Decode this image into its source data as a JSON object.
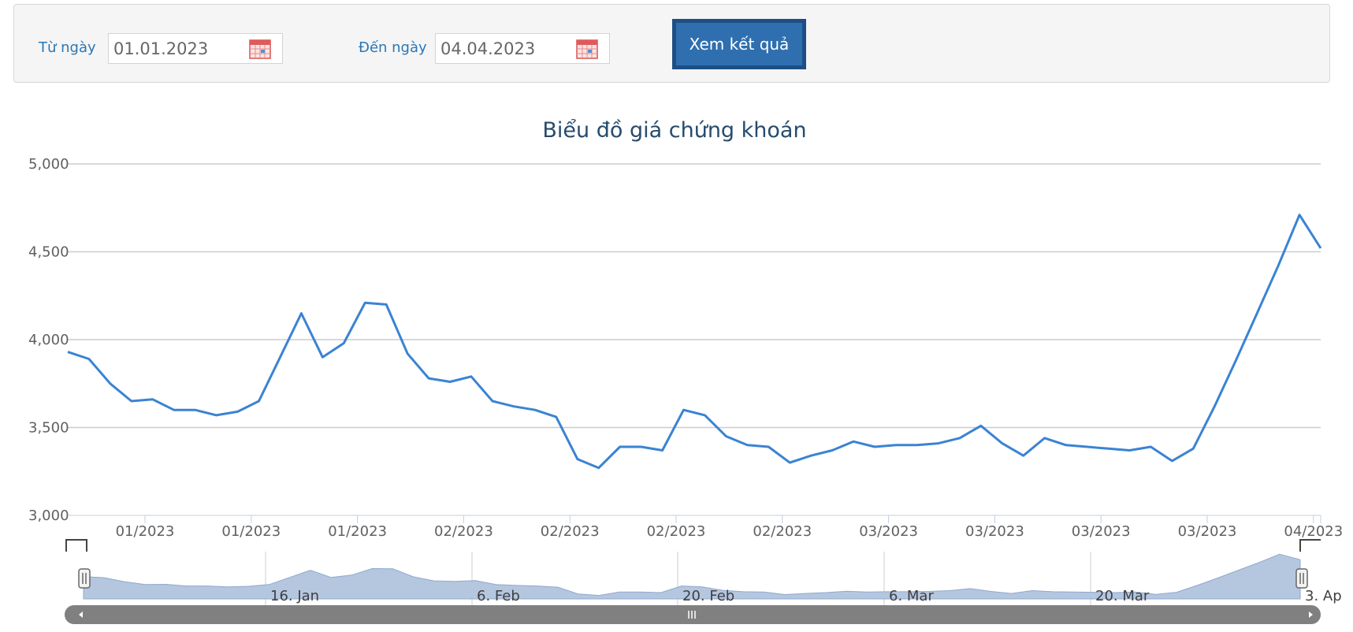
{
  "filter": {
    "from_label": "Từ ngày",
    "from_value": "01.01.2023",
    "to_label": "Đến ngày",
    "to_value": "04.04.2023",
    "submit_label": "Xem kết quả"
  },
  "colors": {
    "accent": "#2a77b6",
    "line": "#3a83d4",
    "button": "#2f6fb0",
    "navigator_fill": "#b5c6df"
  },
  "icons": {
    "calendar": "calendar-icon",
    "scroll_left": "arrow-left-icon",
    "scroll_right": "arrow-right-icon",
    "scrollbar_grip": "grip-icon",
    "handle": "handle-icon"
  },
  "chart_data": {
    "type": "line",
    "title": "Biểu đồ giá chứng khoán",
    "ylim": [
      3000,
      5000
    ],
    "y_ticks": [
      "3,000",
      "3,500",
      "4,000",
      "4,500",
      "5,000"
    ],
    "x_tick_labels": [
      "01/2023",
      "01/2023",
      "01/2023",
      "02/2023",
      "02/2023",
      "02/2023",
      "02/2023",
      "03/2023",
      "03/2023",
      "03/2023",
      "03/2023",
      "04/2023"
    ],
    "grid": true,
    "series": [
      {
        "values": [
          3930,
          3890,
          3750,
          3650,
          3660,
          3600,
          3600,
          3570,
          3590,
          3650,
          3900,
          4150,
          3900,
          3980,
          4210,
          4200,
          3920,
          3780,
          3760,
          3790,
          3650,
          3620,
          3600,
          3560,
          3320,
          3270,
          3390,
          3390,
          3370,
          3600,
          3570,
          3450,
          3400,
          3390,
          3300,
          3340,
          3370,
          3420,
          3390,
          3400,
          3400,
          3410,
          3440,
          3510,
          3410,
          3340,
          3440,
          3400,
          3390,
          3380,
          3370,
          3390,
          3310,
          3380,
          3620,
          3880,
          4150,
          4420,
          4710,
          4520
        ]
      }
    ],
    "navigator": {
      "labels": [
        "16. Jan",
        "6. Feb",
        "20. Feb",
        "6. Mar",
        "20. Mar",
        "3. Ap"
      ]
    }
  }
}
